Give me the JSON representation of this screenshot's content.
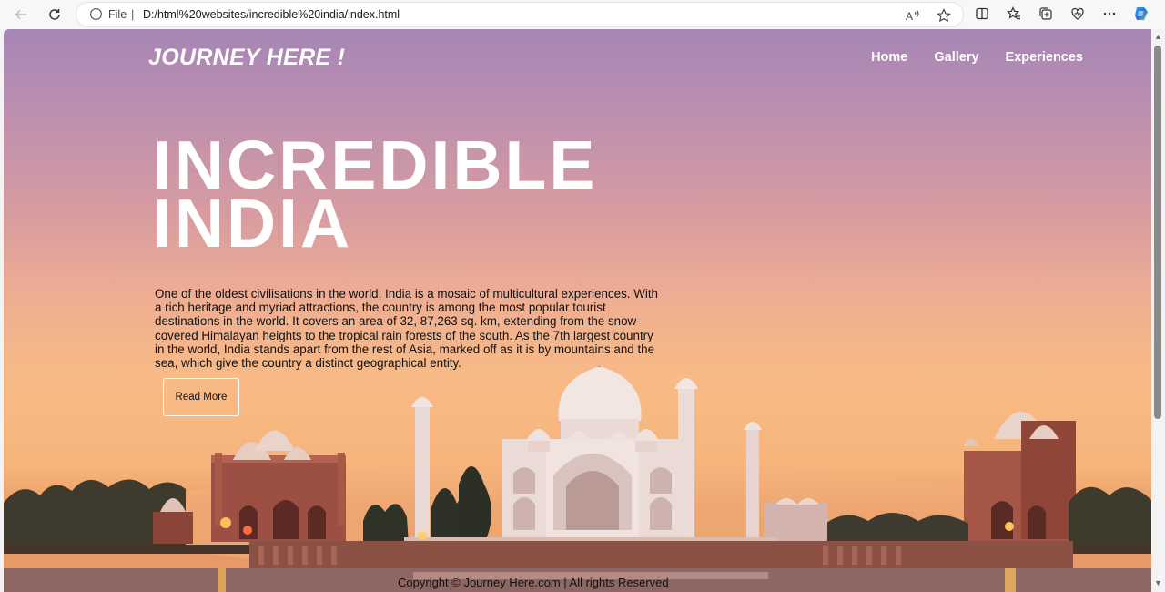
{
  "browser": {
    "url_scheme": "File",
    "url": "D:/html%20websites/incredible%20india/index.html",
    "icons": [
      "back-arrow-icon",
      "refresh-icon",
      "info-icon",
      "read-aloud-icon",
      "favorite-star-icon",
      "split-screen-icon",
      "favorites-icon",
      "collections-icon",
      "browser-essentials-icon",
      "more-icon",
      "copilot-icon"
    ]
  },
  "site": {
    "brand": "JOURNEY HERE !",
    "nav": [
      "Home",
      "Gallery",
      "Experiences"
    ],
    "hero_title_line1": "INCREDIBLE",
    "hero_title_line2": "INDIA",
    "hero_text": "One of the oldest civilisations in the world, India is a mosaic of multicultural experiences. With a rich heritage and myriad attractions, the country is among the most popular tourist destinations in the world. It covers an area of 32, 87,263 sq. km, extending from the snow-covered Himalayan heights to the tropical rain forests of the south. As the 7th largest country in the world, India stands apart from the rest of Asia, marked off as it is by mountains and the sea, which give the country a distinct geographical entity.",
    "read_more": "Read More",
    "footer": "Copyright © Journey Here.com | All rights Reserved"
  },
  "colors": {
    "sky_top": "#a686b6",
    "sky_bottom": "#f8ba86",
    "text_white": "#ffffff"
  }
}
